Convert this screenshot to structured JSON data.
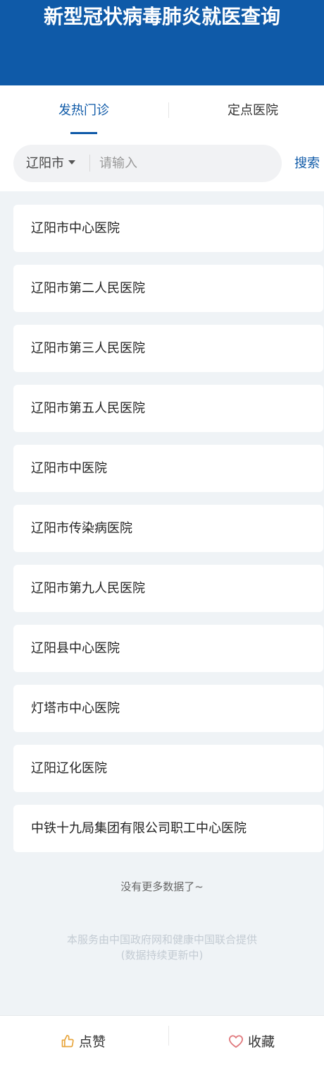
{
  "header": {
    "title": "新型冠状病毒肺炎就医查询"
  },
  "tabs": [
    {
      "label": "发热门诊",
      "active": true
    },
    {
      "label": "定点医院",
      "active": false
    }
  ],
  "search": {
    "city": "辽阳市",
    "placeholder": "请输入",
    "button_label": "搜索"
  },
  "hospitals": [
    {
      "name": "辽阳市中心医院"
    },
    {
      "name": "辽阳市第二人民医院"
    },
    {
      "name": "辽阳市第三人民医院"
    },
    {
      "name": "辽阳市第五人民医院"
    },
    {
      "name": "辽阳市中医院"
    },
    {
      "name": "辽阳市传染病医院"
    },
    {
      "name": "辽阳市第九人民医院"
    },
    {
      "name": "辽阳县中心医院"
    },
    {
      "name": "灯塔市中心医院"
    },
    {
      "name": "辽阳辽化医院"
    },
    {
      "name": "中铁十九局集团有限公司职工中心医院"
    }
  ],
  "list_end_text": "没有更多数据了~",
  "footer": {
    "line1": "本服务由中国政府网和健康中国联合提供",
    "line2": "(数据持续更新中)"
  },
  "bottom_bar": {
    "like_label": "点赞",
    "like_icon": "thumbs-up-icon",
    "favorite_label": "收藏",
    "favorite_icon": "heart-icon"
  },
  "colors": {
    "brand": "#0f5aa8",
    "like_icon": "#e8a53c",
    "heart_icon": "#e0787c"
  }
}
